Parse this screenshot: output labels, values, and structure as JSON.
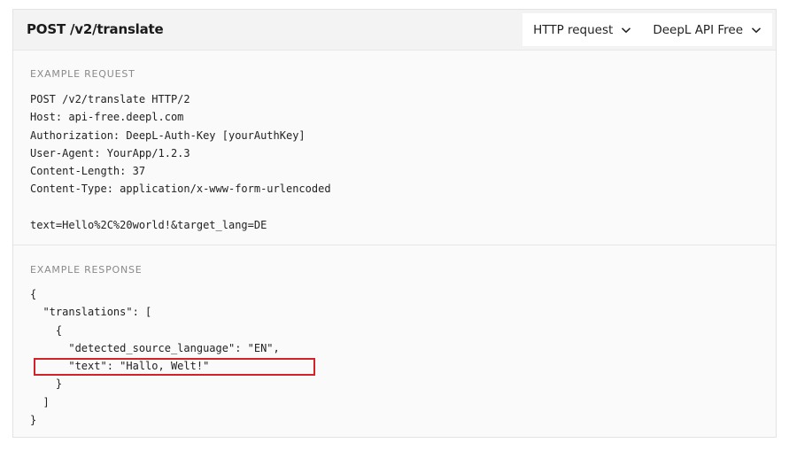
{
  "header": {
    "title": "POST /v2/translate",
    "protocol_dropdown": {
      "selected": "HTTP request",
      "icon": "chevron-down-icon"
    },
    "plan_dropdown": {
      "selected": "DeepL API Free",
      "icon": "chevron-down-icon"
    }
  },
  "request": {
    "label": "EXAMPLE REQUEST",
    "lines": [
      "POST /v2/translate HTTP/2",
      "Host: api-free.deepl.com",
      "Authorization: DeepL-Auth-Key [yourAuthKey]",
      "User-Agent: YourApp/1.2.3",
      "Content-Length: 37",
      "Content-Type: application/x-www-form-urlencoded",
      "",
      "text=Hello%2C%20world!&target_lang=DE"
    ]
  },
  "response": {
    "label": "EXAMPLE RESPONSE",
    "lines": [
      "{",
      "  \"translations\": [",
      "    {",
      "      \"detected_source_language\": \"EN\",",
      "      \"text\": \"Hallo, Welt!\"",
      "    }",
      "  ]",
      "}"
    ],
    "highlight_color": "#d3232a"
  }
}
